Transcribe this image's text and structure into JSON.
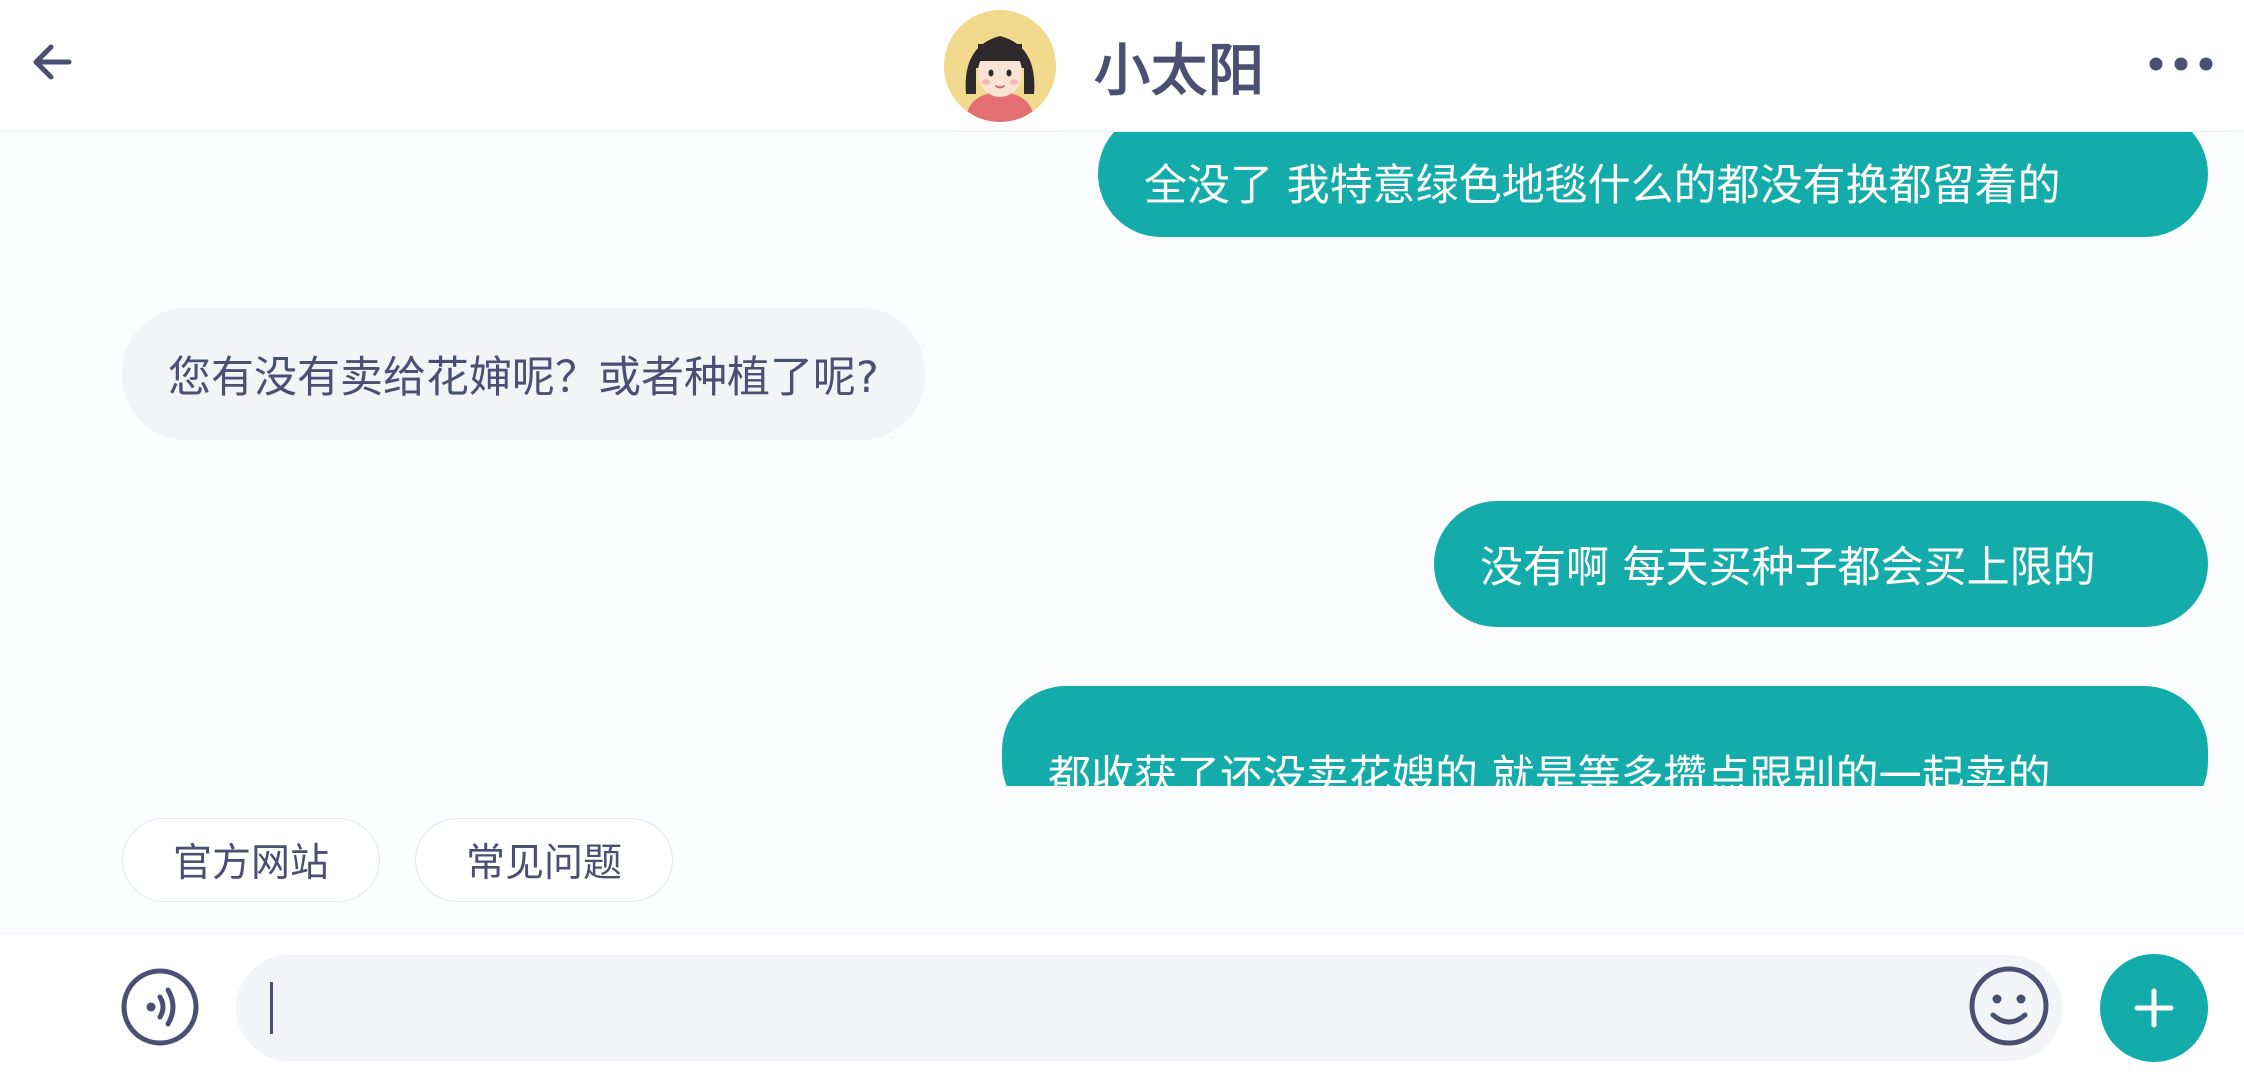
{
  "header": {
    "contact_name": "小太阳",
    "back_icon": "arrow-left-icon",
    "more_icon": "more-dots-icon",
    "avatar_icon": "girl-avatar"
  },
  "messages": [
    {
      "direction": "outgoing",
      "text": "全没了 我特意绿色地毯什么的都没有换都留着的"
    },
    {
      "direction": "incoming",
      "text": "您有没有卖给花婶呢？或者种植了呢?"
    },
    {
      "direction": "outgoing",
      "text": "没有啊 每天买种子都会买上限的"
    },
    {
      "direction": "outgoing",
      "text": "都收获了还没卖花嫂的 就是等多攒点跟别的一起卖的"
    }
  ],
  "quick_replies": [
    {
      "label": "官方网站"
    },
    {
      "label": "常见问题"
    }
  ],
  "input_bar": {
    "value": "",
    "voice_icon": "voice-icon",
    "emoji_icon": "emoji-icon",
    "plus_icon": "plus-icon"
  },
  "colors": {
    "accent": "#13acab",
    "text": "#4a4f73",
    "incoming_bubble": "#f2f4f8"
  }
}
